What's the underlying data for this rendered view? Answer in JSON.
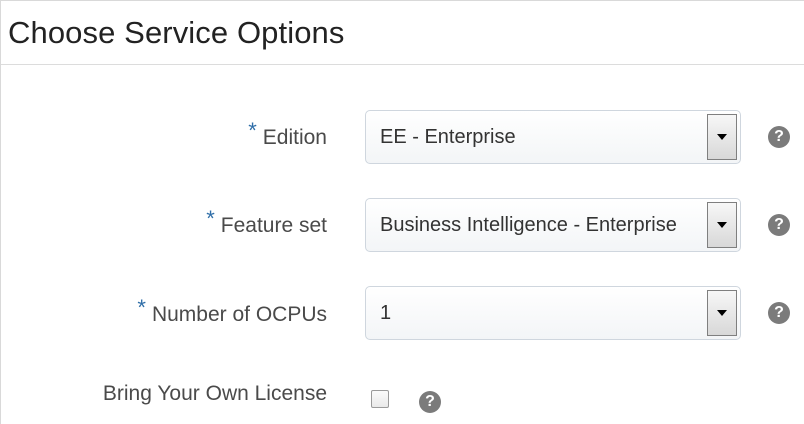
{
  "header": {
    "title": "Choose Service Options"
  },
  "fields": [
    {
      "required": true,
      "required_mark": "*",
      "label": "Edition",
      "value": "EE - Enterprise"
    },
    {
      "required": true,
      "required_mark": "*",
      "label": "Feature set",
      "value": "Business Intelligence - Enterprise"
    },
    {
      "required": true,
      "required_mark": "*",
      "label": "Number of OCPUs",
      "value": "1"
    }
  ],
  "byol": {
    "label": "Bring Your Own License",
    "checked": false
  },
  "help_glyph": "?",
  "icons": {
    "help": "help-icon",
    "dropdown": "chevron-down-icon"
  },
  "colors": {
    "required_mark": "#2f6ea8",
    "help_icon": "#7b7b7b"
  }
}
